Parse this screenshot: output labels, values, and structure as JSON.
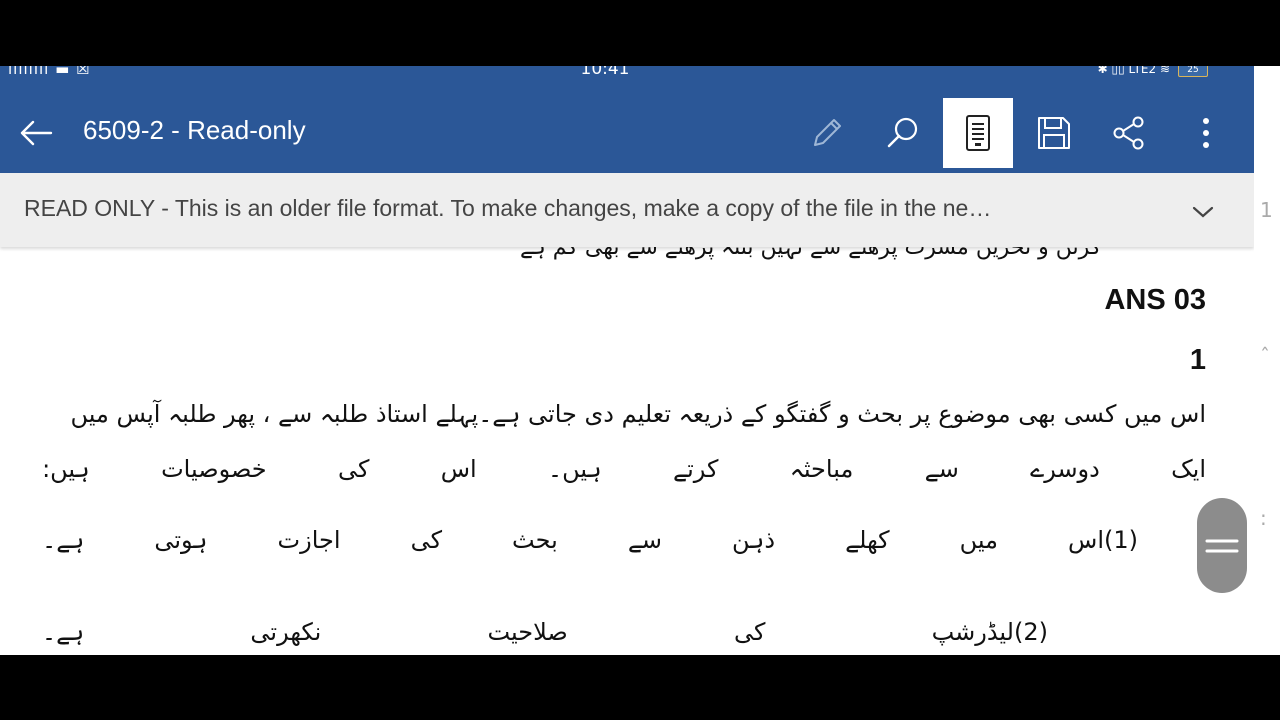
{
  "status_bar": {
    "left_indicators": "ıılıılll ▬ ☒",
    "time": "10:41",
    "right_indicators": "✱ ▯▯ LTE2 ≋",
    "battery": "25"
  },
  "app_bar": {
    "title": "6509-2 - Read-only",
    "colors": {
      "bar": "#2b5797",
      "icon": "#ffffff",
      "disabled_icon": "#9fb7d6"
    }
  },
  "toolbar_icons": [
    "pencil-icon",
    "search-icon",
    "mobile-view-icon",
    "save-icon",
    "share-icon",
    "more-icon"
  ],
  "banner": {
    "text": "READ ONLY - This is an older file format. To make changes, make a copy of the file in the ne…"
  },
  "document": {
    "cut_line_1": "کرنں و تحریں مسرت پرھنے سے نہیں بنتہ پرھنے سے بھی کم ہے",
    "cut_line_2": "ہے",
    "heading": "ANS 03",
    "sub_number": "1",
    "line_1": "اس میں کسی بھی موضوع پر بحث و گفتگو کے ذریعہ تعلیم دی جاتی ہے۔پہلے استاذ طلبہ سے ، پھر طلبہ آپس میں",
    "line_2_words": [
      "ایک",
      "دوسرے",
      "سے",
      "مباحثہ",
      "کرتے",
      "ہیں۔",
      "اس",
      "کی",
      "خصوصیات",
      "ہیں:"
    ],
    "line_3_words": [
      "(1)اس",
      "میں",
      "کھلے",
      "ذہن",
      "سے",
      "بحث",
      "کی",
      "اجازت",
      "ہوتی",
      "ہے۔"
    ],
    "line_4_words": [
      "(2)لیڈرشپ",
      "کی",
      "صلاحیت",
      "نکھرتی",
      "ہے۔"
    ]
  }
}
